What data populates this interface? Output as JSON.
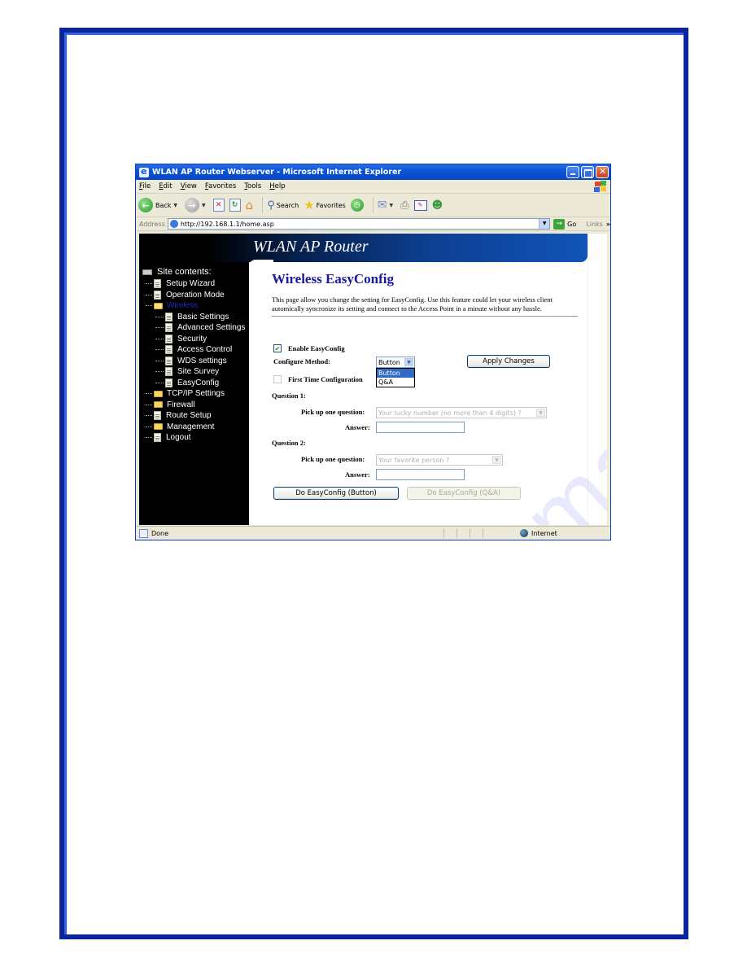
{
  "window": {
    "title": "WLAN AP Router Webserver - Microsoft Internet Explorer",
    "controls": [
      "minimize",
      "maximize",
      "close"
    ]
  },
  "menubar": [
    "File",
    "Edit",
    "View",
    "Favorites",
    "Tools",
    "Help"
  ],
  "toolbar": {
    "back": "Back",
    "search": "Search",
    "favorites": "Favorites"
  },
  "addressbar": {
    "label": "Address",
    "url": "http://192.168.1.1/home.asp",
    "go": "Go",
    "links": "Links",
    "links_chevron": "»"
  },
  "banner": {
    "title": "WLAN AP Router"
  },
  "sidebar": {
    "root": "Site contents:",
    "items": [
      {
        "label": "Setup Wizard",
        "type": "page",
        "level": 0
      },
      {
        "label": "Operation Mode",
        "type": "page",
        "level": 0
      },
      {
        "label": "Wireless",
        "type": "folder-open",
        "level": 0,
        "active": true
      },
      {
        "label": "Basic Settings",
        "type": "page",
        "level": 1
      },
      {
        "label": "Advanced Settings",
        "type": "page",
        "level": 1
      },
      {
        "label": "Security",
        "type": "page",
        "level": 1
      },
      {
        "label": "Access Control",
        "type": "page",
        "level": 1
      },
      {
        "label": "WDS settings",
        "type": "page",
        "level": 1
      },
      {
        "label": "Site Survey",
        "type": "page",
        "level": 1
      },
      {
        "label": "EasyConfig",
        "type": "page",
        "level": 1
      },
      {
        "label": "TCP/IP Settings",
        "type": "folder",
        "level": 0
      },
      {
        "label": "Firewall",
        "type": "folder",
        "level": 0
      },
      {
        "label": "Route Setup",
        "type": "page",
        "level": 0
      },
      {
        "label": "Management",
        "type": "folder",
        "level": 0
      },
      {
        "label": "Logout",
        "type": "page",
        "level": 0
      }
    ]
  },
  "main": {
    "title": "Wireless EasyConfig",
    "description": "This page allow you change the setting for EasyConfig. Use this feature could let your wireless client automically syncronize its setting and connect to the Access Point in a minute without any hassle.",
    "enable_label": "Enable EasyConfig",
    "enable_checked": true,
    "configure_method_label": "Configure Method:",
    "configure_method_value": "Button",
    "configure_method_options": [
      "Button",
      "Q&A"
    ],
    "apply_button": "Apply Changes",
    "first_time_label": "First Time Configuration",
    "first_time_checked": false,
    "question1": {
      "heading": "Question 1:",
      "pick_label": "Pick up one question:",
      "pick_value": "Your lucky number (no more than 4 digits) ?",
      "answer_label": "Answer:",
      "answer_value": ""
    },
    "question2": {
      "heading": "Question 2:",
      "pick_label": "Pick up one question:",
      "pick_value": "Your favorite person ?",
      "answer_label": "Answer:",
      "answer_value": ""
    },
    "do_button": "Do EasyConfig (Button)",
    "do_qa_button": "Do EasyConfig (Q&A)"
  },
  "statusbar": {
    "status": "Done",
    "zone": "Internet"
  },
  "watermark": "manualsrive.com",
  "colors": {
    "frame": "#0a259c",
    "title_blue": "#1a1a9a",
    "sidebar_bg": "#000000",
    "selected_option": "#316ac5"
  }
}
